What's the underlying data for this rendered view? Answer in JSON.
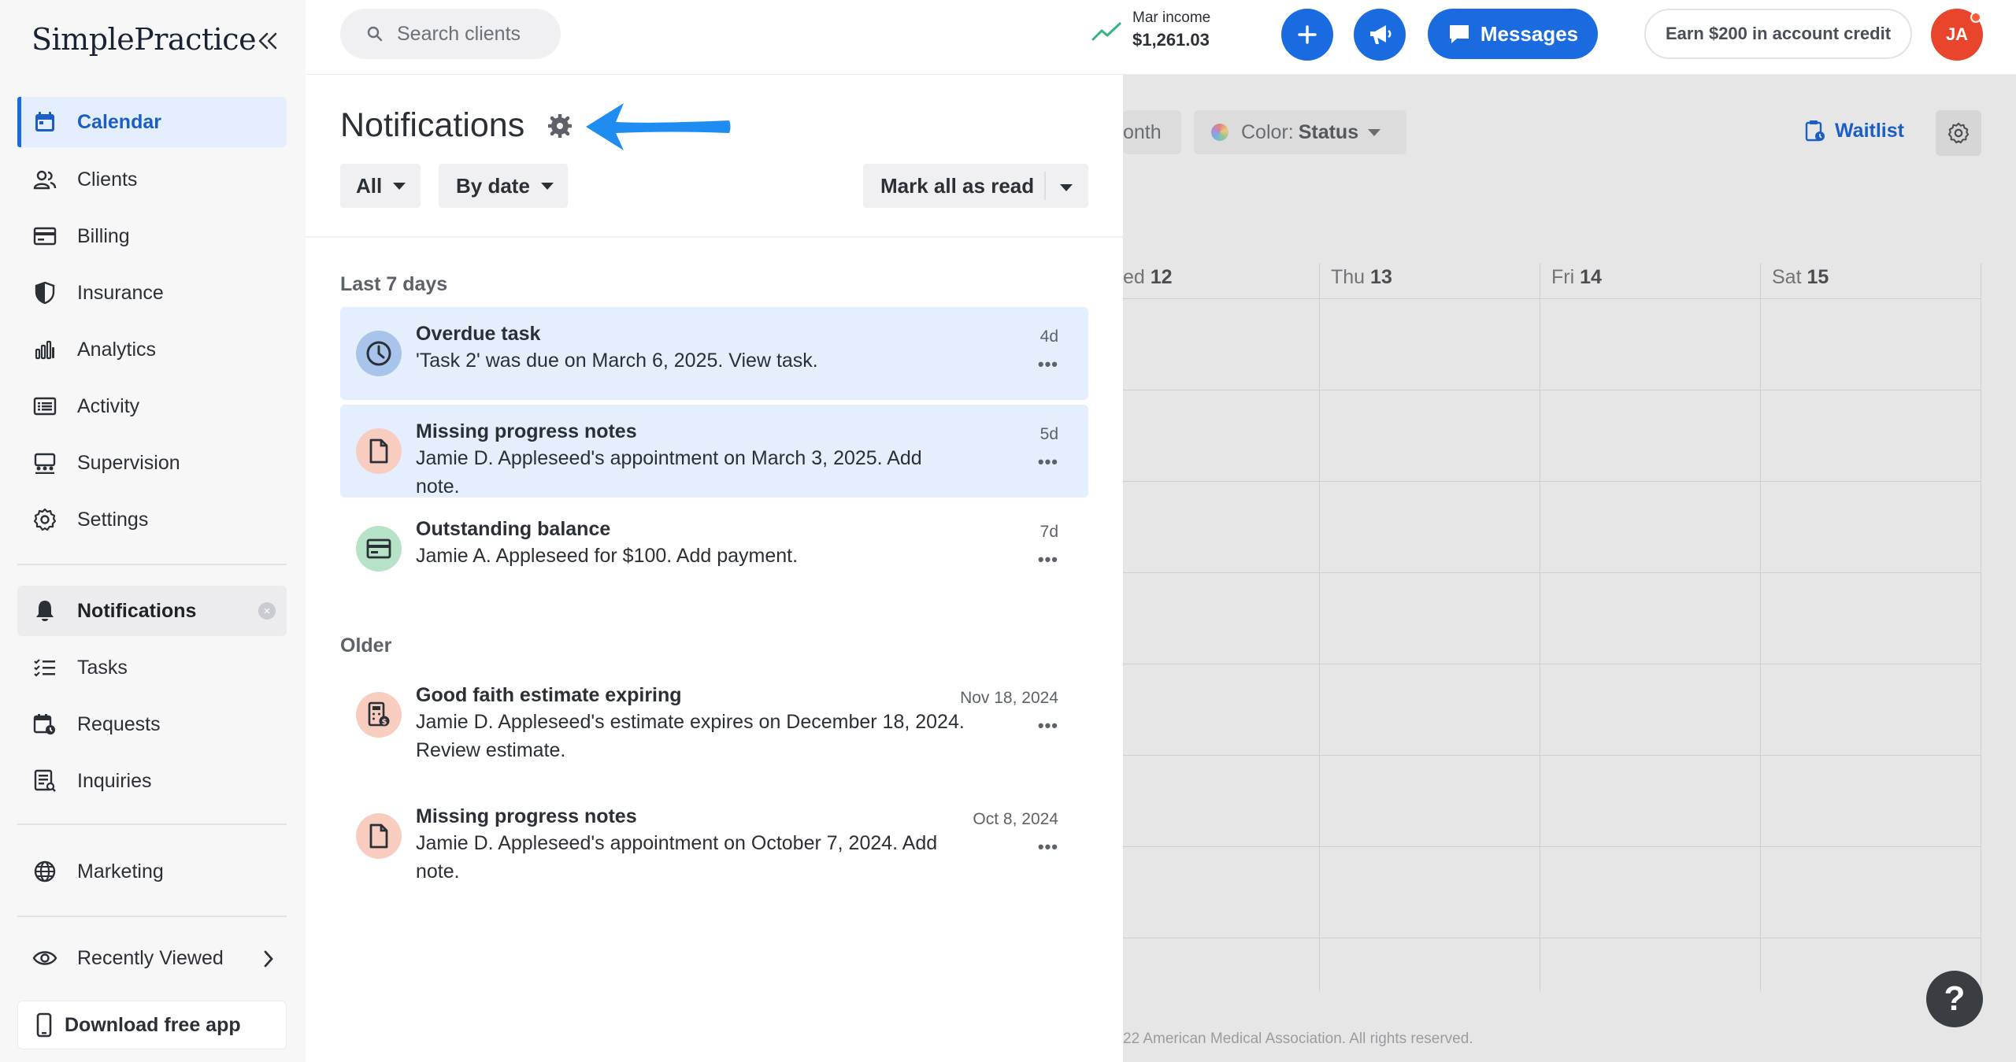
{
  "app": {
    "logo_text": "SimplePractice"
  },
  "sidebar": {
    "items": [
      {
        "label": "Calendar",
        "icon": "calendar-icon"
      },
      {
        "label": "Clients",
        "icon": "users-icon"
      },
      {
        "label": "Billing",
        "icon": "card-icon"
      },
      {
        "label": "Insurance",
        "icon": "shield-icon"
      },
      {
        "label": "Analytics",
        "icon": "bar-chart-icon"
      },
      {
        "label": "Activity",
        "icon": "list-icon"
      },
      {
        "label": "Supervision",
        "icon": "supervision-icon"
      },
      {
        "label": "Settings",
        "icon": "gear-icon"
      }
    ],
    "items2": [
      {
        "label": "Notifications",
        "icon": "bell-icon"
      },
      {
        "label": "Tasks",
        "icon": "tasks-icon"
      },
      {
        "label": "Requests",
        "icon": "requests-icon"
      },
      {
        "label": "Inquiries",
        "icon": "inquiries-icon"
      }
    ],
    "marketing": {
      "label": "Marketing",
      "icon": "globe-icon"
    },
    "recently_viewed": {
      "label": "Recently Viewed",
      "icon": "eye-icon"
    },
    "download": {
      "label": "Download free app",
      "icon": "phone-icon"
    }
  },
  "topbar": {
    "search_placeholder": "Search clients",
    "income_label": "Mar income",
    "income_value": "$1,261.03",
    "messages_label": "Messages",
    "earn_label": "Earn $200 in account credit",
    "avatar_initials": "JA"
  },
  "calendar": {
    "view_btn": "onth",
    "color_label": "Color: ",
    "color_value": "Status",
    "waitlist": "Waitlist",
    "days": [
      {
        "name": "ed",
        "num": "12"
      },
      {
        "name": "Thu",
        "num": "13"
      },
      {
        "name": "Fri",
        "num": "14"
      },
      {
        "name": "Sat",
        "num": "15"
      }
    ],
    "copyright": "22 American Medical Association. All rights reserved.",
    "help": "?"
  },
  "notifications": {
    "title": "Notifications",
    "filter_all": "All",
    "filter_date": "By date",
    "mark_all": "Mark all as read",
    "section_recent": "Last 7 days",
    "section_older": "Older",
    "recent": [
      {
        "title": "Overdue task",
        "body": "'Task 2' was due on March 6, 2025. View task.",
        "time": "4d",
        "more": "•••",
        "icon": "clock-icon",
        "color": "#a9c4ea",
        "unread": true
      },
      {
        "title": "Missing progress notes",
        "body": "Jamie D. Appleseed's appointment on March 3, 2025. Add note.",
        "time": "5d",
        "more": "•••",
        "icon": "document-icon",
        "color": "#f8cdbf",
        "unread": true
      },
      {
        "title": "Outstanding balance",
        "body": "Jamie A. Appleseed for $100. Add payment.",
        "time": "7d",
        "more": "•••",
        "icon": "card-icon",
        "color": "#b6e3c8",
        "unread": false
      }
    ],
    "older": [
      {
        "title": "Good faith estimate expiring",
        "body": "Jamie D. Appleseed's estimate expires on December 18, 2024. Review estimate.",
        "time": "Nov 18, 2024",
        "more": "•••",
        "icon": "calculator-icon",
        "color": "#f8cdbf"
      },
      {
        "title": "Missing progress notes",
        "body": "Jamie D. Appleseed's appointment on October 7, 2024. Add note.",
        "time": "Oct 8, 2024",
        "more": "•••",
        "icon": "document-icon",
        "color": "#f8cdbf"
      }
    ]
  },
  "colors": {
    "accent": "#1b6be0",
    "arrow": "#1e8cf0",
    "avatar": "#e8452c"
  }
}
